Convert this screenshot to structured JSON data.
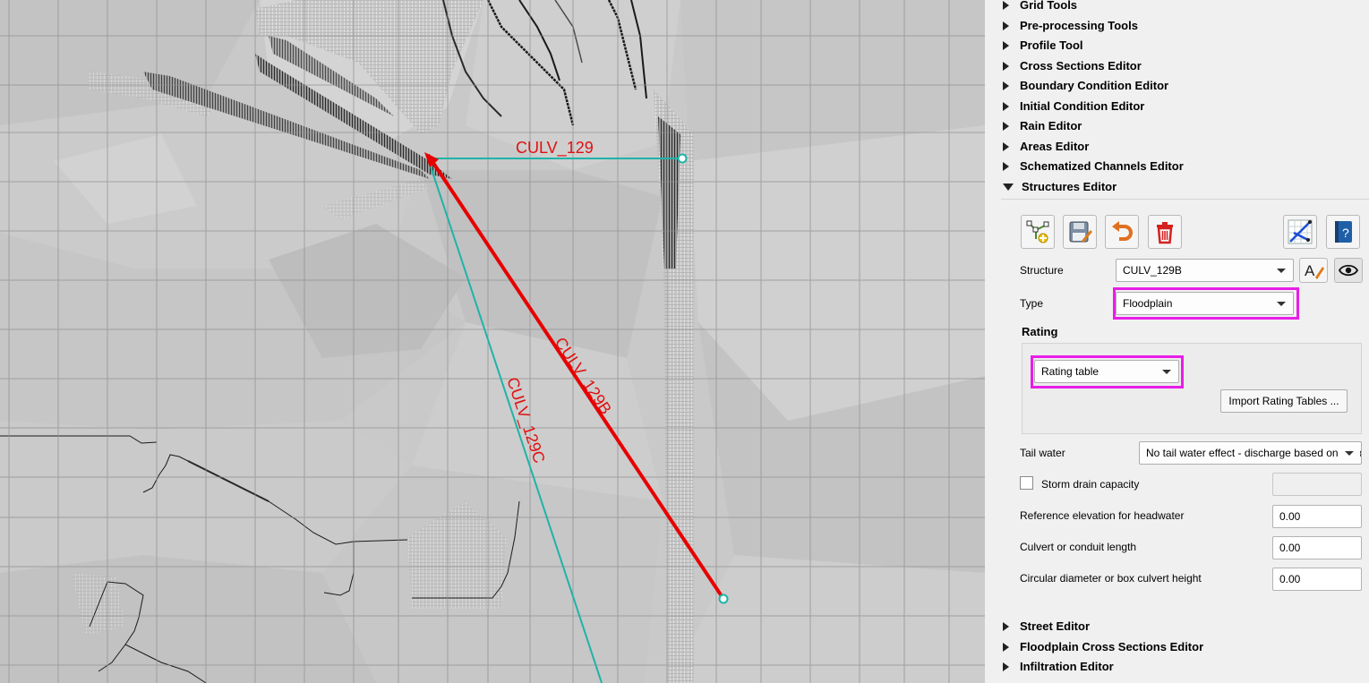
{
  "map": {
    "labels": {
      "culv_129": "CULV_129",
      "culv_129b": "CULV_129B",
      "culv_129c": "CULV_129C"
    },
    "colors": {
      "selected_line": "#e60000",
      "structure_line": "#1fb3a8",
      "label": "#e01010",
      "grid": "#8e8e8e",
      "background": "#c9c9c9"
    }
  },
  "panel": {
    "sections_top": [
      {
        "label": "Grid Tools"
      },
      {
        "label": "Pre-processing Tools"
      },
      {
        "label": "Profile Tool"
      },
      {
        "label": "Cross Sections Editor"
      },
      {
        "label": "Boundary Condition Editor"
      },
      {
        "label": "Initial Condition Editor"
      },
      {
        "label": "Rain Editor"
      },
      {
        "label": "Areas Editor"
      },
      {
        "label": "Schematized Channels Editor"
      }
    ],
    "structures_editor": {
      "label": "Structures Editor",
      "toolbar": {
        "add_icon": "add-structure-icon",
        "save_icon": "save-icon",
        "undo_icon": "undo-icon",
        "delete_icon": "trash-icon",
        "schematize_icon": "schematize-icon",
        "help_icon": "help-book-icon"
      },
      "structure_label": "Structure",
      "structure_value": "CULV_129B",
      "type_label": "Type",
      "type_value": "Floodplain",
      "rating_label": "Rating",
      "rating_value": "Rating table",
      "import_button": "Import Rating Tables ...",
      "tail_water_label": "Tail water",
      "tail_water_value": "No tail water effect - discharge based on headwater",
      "storm_drain_label": "Storm drain capacity",
      "storm_drain_checked": false,
      "storm_drain_value": "",
      "ref_elev_label": "Reference elevation for headwater",
      "ref_elev_value": "0.00",
      "culvert_length_label": "Culvert or conduit length",
      "culvert_length_value": "0.00",
      "diameter_label": "Circular diameter or box culvert height",
      "diameter_value": "0.00",
      "highlight_color": "#e81de8"
    },
    "sections_bottom": [
      {
        "label": "Street Editor"
      },
      {
        "label": "Floodplain Cross Sections Editor"
      },
      {
        "label": "Infiltration Editor"
      }
    ]
  }
}
